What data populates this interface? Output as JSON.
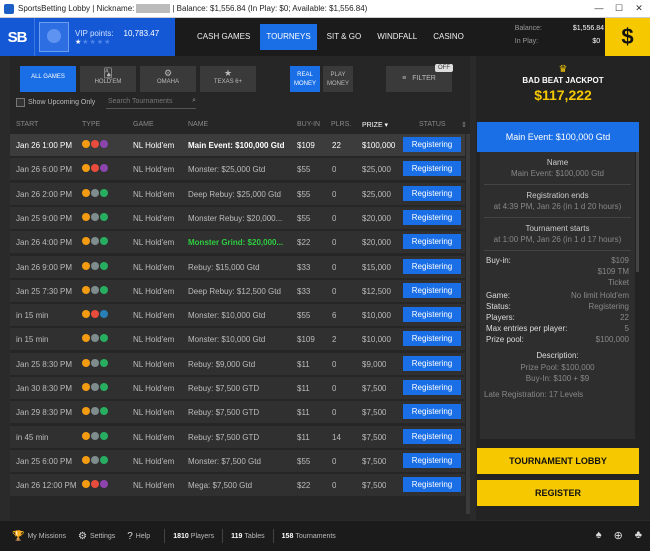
{
  "window": {
    "title_prefix": "SportsBetting Lobby | Nickname:",
    "title_suffix": "| Balance: $1,556.84 (In Play: $0; Available: $1,556.84)",
    "minimize": "—",
    "maximize": "☐",
    "close": "✕"
  },
  "header": {
    "logo": "SB",
    "vip_label": "VIP points:",
    "vip_value": "10,783.47",
    "stars_on": "★",
    "stars_off": "★★★★",
    "tabs": [
      "CASH GAMES",
      "TOURNEYS",
      "SIT & GO",
      "WINDFALL",
      "CASINO"
    ],
    "active_tab": 1,
    "balance_label": "Balance:",
    "balance_value": "$1,556.84",
    "inplay_label": "In Play:",
    "inplay_value": "$0",
    "cashier_icon": "$"
  },
  "filters": {
    "games": [
      {
        "label": "ALL GAMES",
        "icon": ""
      },
      {
        "label": "HOLD'EM",
        "icon": "🂡"
      },
      {
        "label": "OMAHA",
        "icon": "⚙"
      },
      {
        "label": "TEXAS 6+",
        "icon": "★"
      }
    ],
    "money": [
      "REAL MONEY",
      "PLAY MONEY"
    ],
    "filter_label": "FILTER",
    "filter_icon": "≡",
    "toggle": "OFF",
    "show_upcoming": "Show Upcoming Only",
    "search_placeholder": "Search Tournaments",
    "search_icon": "⌕"
  },
  "table": {
    "columns": {
      "start": "START",
      "type": "TYPE",
      "game": "GAME",
      "name": "NAME",
      "buyin": "BUY-IN",
      "plrs": "PLRS.",
      "prize": "PRIZE ▾",
      "status": "STATUS",
      "sort": "⇕"
    },
    "rows": [
      {
        "start": "Jan 26 1:00 PM",
        "game": "NL Hold'em",
        "name": "Main Event: $100,000 Gtd",
        "buyin": "$109",
        "plrs": "22",
        "prize": "$100,000",
        "status": "Registering",
        "style": "bold",
        "selected": true,
        "types": [
          "#f39c12",
          "#e74c3c",
          "#8e44ad"
        ]
      },
      {
        "start": "Jan 26 6:00 PM",
        "game": "NL Hold'em",
        "name": "Monster: $25,000 Gtd",
        "buyin": "$55",
        "plrs": "0",
        "prize": "$25,000",
        "status": "Registering",
        "style": "",
        "selected": false,
        "types": [
          "#f39c12",
          "#e74c3c",
          "#8e44ad"
        ]
      },
      {
        "start": "Jan 26 2:00 PM",
        "game": "NL Hold'em",
        "name": "Deep Rebuy: $25,000 Gtd",
        "buyin": "$55",
        "plrs": "0",
        "prize": "$25,000",
        "status": "Registering",
        "style": "",
        "selected": false,
        "types": [
          "#f39c12",
          "#7f8c8d",
          "#27ae60"
        ]
      },
      {
        "start": "Jan 25 9:00 PM",
        "game": "NL Hold'em",
        "name": "Monster Rebuy: $20,000...",
        "buyin": "$55",
        "plrs": "0",
        "prize": "$20,000",
        "status": "Registering",
        "style": "",
        "selected": false,
        "types": [
          "#f39c12",
          "#7f8c8d",
          "#27ae60"
        ]
      },
      {
        "start": "Jan 26 4:00 PM",
        "game": "NL Hold'em",
        "name": "Monster Grind: $20,000...",
        "buyin": "$22",
        "plrs": "0",
        "prize": "$20,000",
        "status": "Registering",
        "style": "green",
        "selected": false,
        "types": [
          "#f39c12",
          "#7f8c8d",
          "#27ae60"
        ]
      },
      {
        "start": "Jan 26 9:00 PM",
        "game": "NL Hold'em",
        "name": "Rebuy: $15,000 Gtd",
        "buyin": "$33",
        "plrs": "0",
        "prize": "$15,000",
        "status": "Registering",
        "style": "",
        "selected": false,
        "types": [
          "#f39c12",
          "#7f8c8d",
          "#27ae60"
        ]
      },
      {
        "start": "Jan 25 7:30 PM",
        "game": "NL Hold'em",
        "name": "Deep Rebuy: $12,500 Gtd",
        "buyin": "$33",
        "plrs": "0",
        "prize": "$12,500",
        "status": "Registering",
        "style": "",
        "selected": false,
        "types": [
          "#f39c12",
          "#7f8c8d",
          "#27ae60"
        ]
      },
      {
        "start": "in 15 min",
        "game": "NL Hold'em",
        "name": "Monster: $10,000 Gtd",
        "buyin": "$55",
        "plrs": "6",
        "prize": "$10,000",
        "status": "Registering",
        "style": "",
        "selected": false,
        "types": [
          "#f39c12",
          "#e74c3c",
          "#2980b9"
        ]
      },
      {
        "start": "in 15 min",
        "game": "NL Hold'em",
        "name": "Monster: $10,000 Gtd",
        "buyin": "$109",
        "plrs": "2",
        "prize": "$10,000",
        "status": "Registering",
        "style": "",
        "selected": false,
        "types": [
          "#f39c12",
          "#7f8c8d",
          "#27ae60"
        ]
      },
      {
        "start": "Jan 25 8:30 PM",
        "game": "NL Hold'em",
        "name": "Rebuy: $9,000 Gtd",
        "buyin": "$11",
        "plrs": "0",
        "prize": "$9,000",
        "status": "Registering",
        "style": "",
        "selected": false,
        "types": [
          "#f39c12",
          "#7f8c8d",
          "#27ae60"
        ]
      },
      {
        "start": "Jan 30 8:30 PM",
        "game": "NL Hold'em",
        "name": "Rebuy: $7,500 GTD",
        "buyin": "$11",
        "plrs": "0",
        "prize": "$7,500",
        "status": "Registering",
        "style": "",
        "selected": false,
        "types": [
          "#f39c12",
          "#7f8c8d",
          "#27ae60"
        ]
      },
      {
        "start": "Jan 29 8:30 PM",
        "game": "NL Hold'em",
        "name": "Rebuy: $7,500 GTD",
        "buyin": "$11",
        "plrs": "0",
        "prize": "$7,500",
        "status": "Registering",
        "style": "",
        "selected": false,
        "types": [
          "#f39c12",
          "#7f8c8d",
          "#27ae60"
        ]
      },
      {
        "start": "in 45 min",
        "game": "NL Hold'em",
        "name": "Rebuy: $7,500 GTD",
        "buyin": "$11",
        "plrs": "14",
        "prize": "$7,500",
        "status": "Registering",
        "style": "",
        "selected": false,
        "types": [
          "#f39c12",
          "#7f8c8d",
          "#27ae60"
        ]
      },
      {
        "start": "Jan 25 6:00 PM",
        "game": "NL Hold'em",
        "name": "Monster: $7,500 Gtd",
        "buyin": "$55",
        "plrs": "0",
        "prize": "$7,500",
        "status": "Registering",
        "style": "",
        "selected": false,
        "types": [
          "#f39c12",
          "#7f8c8d",
          "#27ae60"
        ]
      },
      {
        "start": "Jan 26 12:00 PM",
        "game": "NL Hold'em",
        "name": "Mega: $7,500 Gtd",
        "buyin": "$22",
        "plrs": "0",
        "prize": "$7,500",
        "status": "Registering",
        "style": "",
        "selected": false,
        "types": [
          "#f39c12",
          "#e74c3c",
          "#8e44ad"
        ]
      }
    ]
  },
  "side": {
    "trophy_icon": "♛",
    "jackpot_label": "BAD BEAT JACKPOT",
    "jackpot_value": "$117,222",
    "selected_title": "Main Event: $100,000 Gtd",
    "name_label": "Name",
    "name_value": "Main Event: $100,000 Gtd",
    "reg_ends_label": "Registration ends",
    "reg_ends_value": "at 4:39 PM, Jan 26 (in 1 d 20 hours)",
    "starts_label": "Tournament starts",
    "starts_value": "at 1:00 PM, Jan 26 (in 1 d 17 hours)",
    "buyin_label": "Buy-in:",
    "buyin_values": [
      "$109",
      "$109 TM",
      "Ticket"
    ],
    "kv": [
      {
        "k": "Game:",
        "v": "No limit Hold'em"
      },
      {
        "k": "Status:",
        "v": "Registering"
      },
      {
        "k": "Players:",
        "v": "22"
      },
      {
        "k": "Max entries per player:",
        "v": "5"
      },
      {
        "k": "Prize pool:",
        "v": "$100,000"
      }
    ],
    "desc_label": "Description:",
    "desc_lines": [
      "Prize Pool: $100,000",
      "Buy-In: $100 + $9"
    ],
    "late_reg": "Late Registration: 17 Levels",
    "lobby_button": "TOURNAMENT LOBBY",
    "register_button": "REGISTER"
  },
  "footer": {
    "missions": "My Missions",
    "settings": "Settings",
    "help": "Help",
    "players_count": "1810",
    "players_label": "Players",
    "tables_count": "119",
    "tables_label": "Tables",
    "tourneys_count": "158",
    "tourneys_label": "Tournaments",
    "missions_icon": "🏆",
    "settings_icon": "⚙",
    "help_icon": "?",
    "right_icons": [
      "♠",
      "⊕",
      "♣"
    ]
  }
}
